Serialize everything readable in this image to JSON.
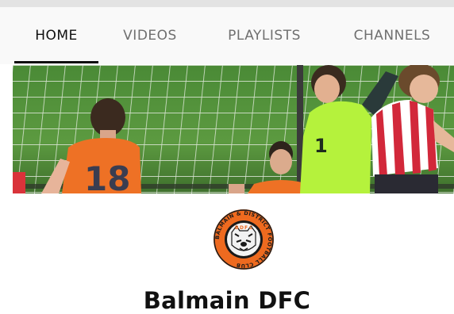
{
  "tabs": [
    {
      "label": "HOME",
      "active": true
    },
    {
      "label": "VIDEOS",
      "active": false
    },
    {
      "label": "PLAYLISTS",
      "active": false
    },
    {
      "label": "CHANNELS",
      "active": false
    }
  ],
  "banner": {
    "jersey_number": "18"
  },
  "avatar": {
    "ring_text": "BALMAIN & DISTRICT FOOTBALL CLUB",
    "colors": {
      "ring": "#ee6a1f",
      "inner": "#1a1a1a"
    }
  },
  "channel": {
    "name": "Balmain DFC"
  },
  "colors": {
    "accent_orange": "#ee7125",
    "keeper_green": "#b5f23c",
    "tab_active": "#0f0f0f",
    "tab_inactive": "#6f6f6f"
  }
}
